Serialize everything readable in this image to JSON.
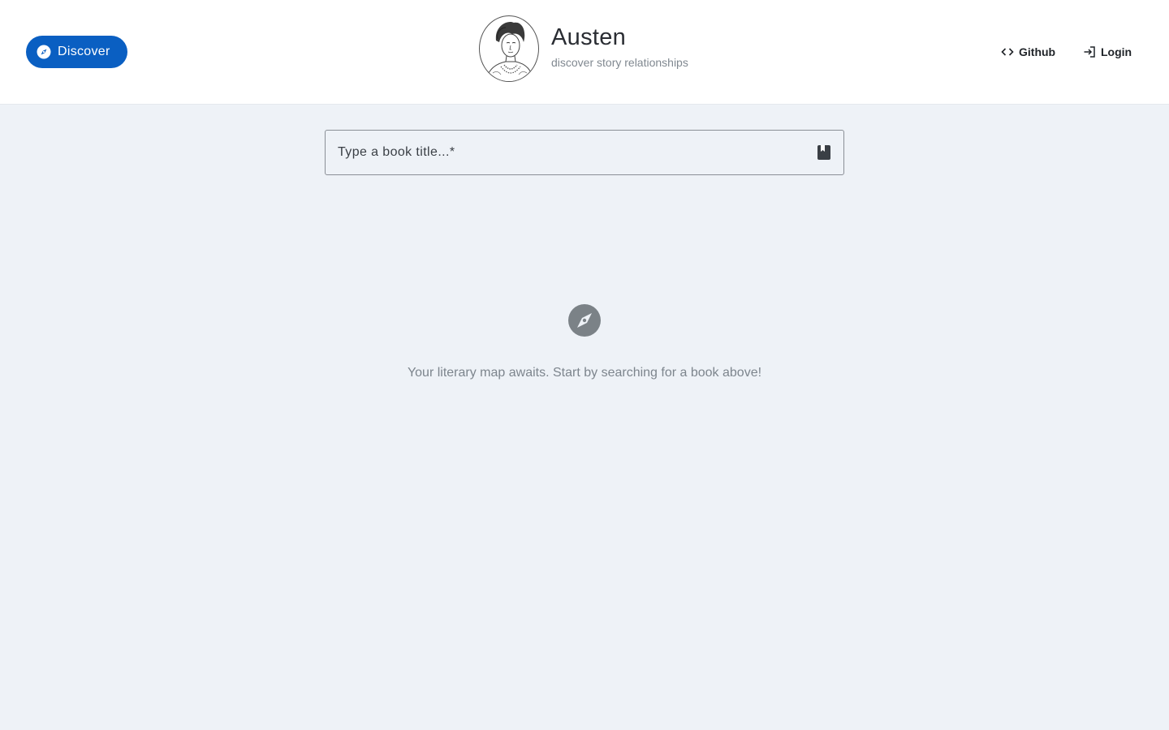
{
  "header": {
    "discover_label": "Discover",
    "brand_title": "Austen",
    "brand_subtitle": "discover story relationships",
    "github_label": "Github",
    "login_label": "Login"
  },
  "search": {
    "placeholder": "Type a book title...*"
  },
  "empty_state": {
    "message": "Your literary map awaits. Start by searching for a book above!"
  },
  "icons": {
    "discover": "compass-icon",
    "github": "code-icon",
    "login": "login-icon",
    "search": "book-icon",
    "empty": "compass-icon"
  },
  "colors": {
    "primary": "#0a5fc2",
    "background": "#eef2f7",
    "header": "#ffffff",
    "muted": "#7d858d"
  }
}
